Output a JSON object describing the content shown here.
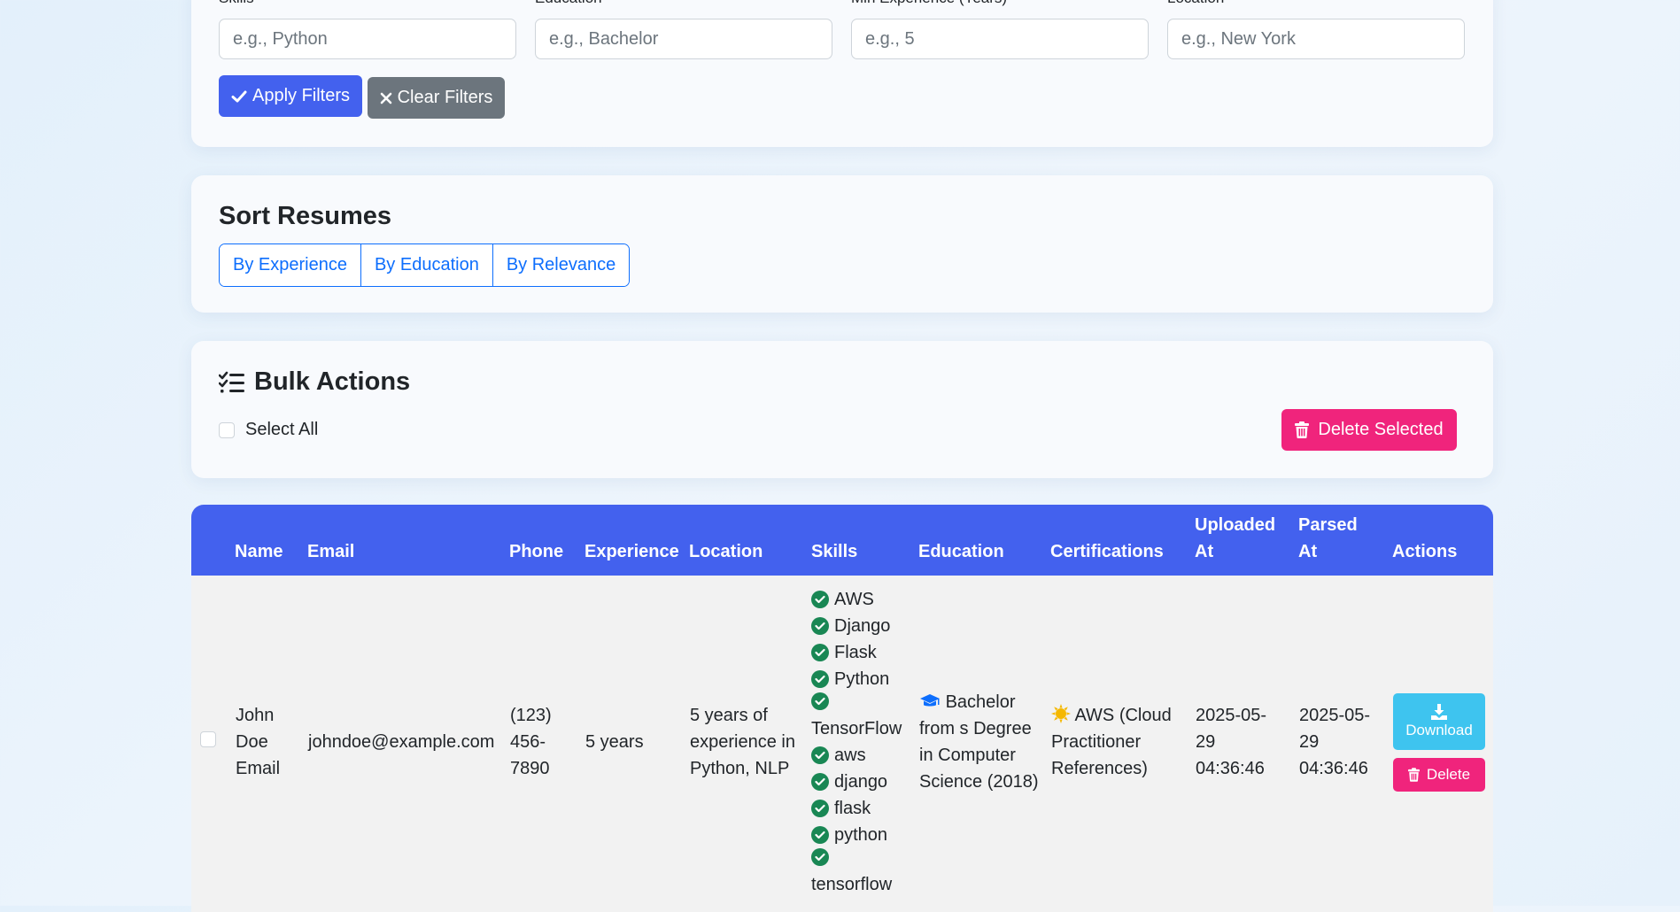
{
  "filters": {
    "skills": {
      "label": "Skills",
      "placeholder": "e.g., Python"
    },
    "education": {
      "label": "Education",
      "placeholder": "e.g., Bachelor"
    },
    "experience": {
      "label": "Min Experience (Years)",
      "placeholder": "e.g., 5"
    },
    "location": {
      "label": "Location",
      "placeholder": "e.g., New York"
    },
    "apply_label": "Apply Filters",
    "clear_label": "Clear Filters"
  },
  "sort": {
    "title": "Sort Resumes",
    "options": [
      "By Experience",
      "By Education",
      "By Relevance"
    ]
  },
  "bulk": {
    "title": "Bulk Actions",
    "select_all_label": "Select All",
    "delete_selected_label": "Delete Selected"
  },
  "table": {
    "headers": {
      "name": "Name",
      "email": "Email",
      "phone": "Phone",
      "experience": "Experience",
      "location": "Location",
      "skills": "Skills",
      "education": "Education",
      "certifications": "Certifications",
      "uploaded_at": "Uploaded At",
      "parsed_at": "Parsed At",
      "actions": "Actions"
    },
    "rows": [
      {
        "name": "John Doe Email",
        "email": "johndoe@example.com",
        "phone": "(123) 456-7890",
        "experience": "5 years",
        "location": "5 years of experience in Python, NLP",
        "skills": [
          "AWS",
          "Django",
          "Flask",
          "Python",
          "TensorFlow",
          "aws",
          "django",
          "flask",
          "python",
          "tensorflow"
        ],
        "education": "Bachelor from s Degree in Computer Science (2018)",
        "certifications": "AWS (Cloud Practitioner References)",
        "uploaded_at": "2025-05-29 04:36:46",
        "parsed_at": "2025-05-29 04:36:46",
        "download_label": "Download",
        "delete_label": "Delete"
      }
    ]
  },
  "colors": {
    "primary": "#4361ee",
    "secondary": "#6c757d",
    "danger": "#f0247c",
    "info": "#3ec4ef",
    "success": "#198754",
    "outline": "#0d6efd"
  },
  "icons": {
    "apply": "check-icon",
    "clear": "x-icon",
    "bulk": "list-check-icon",
    "delete": "trash-icon",
    "download": "download-icon",
    "skill": "check-circle-icon",
    "education": "graduation-cap-icon",
    "certification": "sun-badge-icon"
  }
}
